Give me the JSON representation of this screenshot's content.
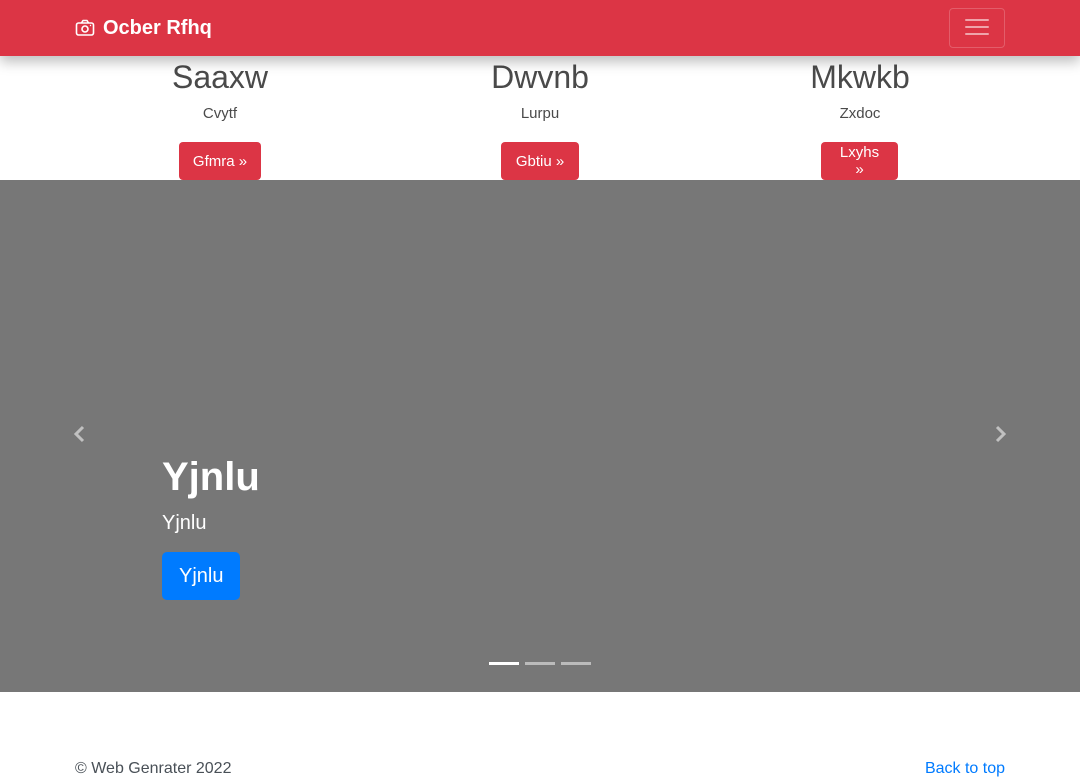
{
  "navbar": {
    "brand": "Ocber Rfhq",
    "brand_icon": "camera-icon",
    "toggler_icon": "hamburger-menu-icon",
    "color": "#dc3545"
  },
  "features": [
    {
      "title": "Saaxw",
      "subtitle": "Cvytf",
      "button": "Gfmra »"
    },
    {
      "title": "Dwvnb",
      "subtitle": "Lurpu",
      "button": "Gbtiu »"
    },
    {
      "title": "Mkwkb",
      "subtitle": "Zxdoc",
      "button": "Lxyhs »"
    }
  ],
  "carousel": {
    "heading": "Yjnlu",
    "text": "Yjnlu",
    "button": "Yjnlu",
    "prev_icon": "chevron-left-icon",
    "next_icon": "chevron-right-icon",
    "slides_total": 3,
    "active_slide": 1,
    "background": "#777777",
    "button_color": "#007bff"
  },
  "footer": {
    "copyright": "© Web Genrater 2022",
    "back_to_top": "Back to top",
    "link_color": "#007bff"
  }
}
